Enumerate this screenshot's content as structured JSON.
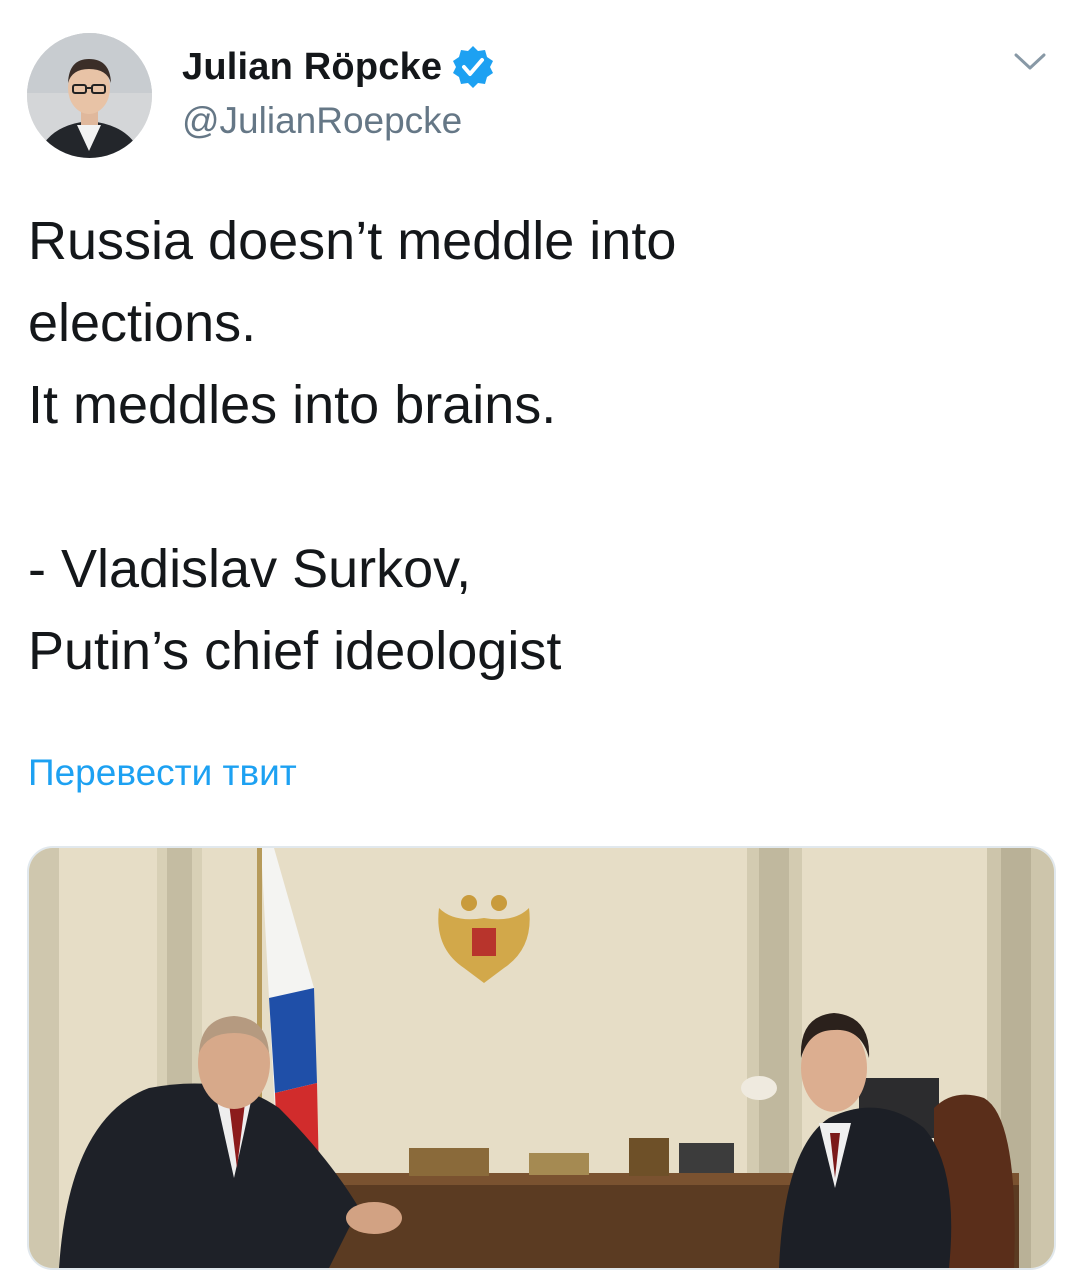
{
  "tweet": {
    "author": {
      "display_name": "Julian Röpcke",
      "handle": "@JulianRoepcke",
      "verified": true,
      "avatar_icon": "profile-photo"
    },
    "text_lines": [
      "Russia doesn’t meddle into",
      "elections.",
      "It meddles into brains.",
      "",
      "- Vladislav Surkov,",
      "Putin’s chief ideologist"
    ],
    "translate_label": "Перевести твит",
    "media": {
      "type": "photo",
      "icon": "photo-meeting-in-office"
    },
    "menu_icon": "chevron-down-icon"
  },
  "colors": {
    "text": "#14171a",
    "secondary": "#657786",
    "link": "#1da1f2",
    "verified": "#1da1f2",
    "border": "#e1e8ed"
  }
}
